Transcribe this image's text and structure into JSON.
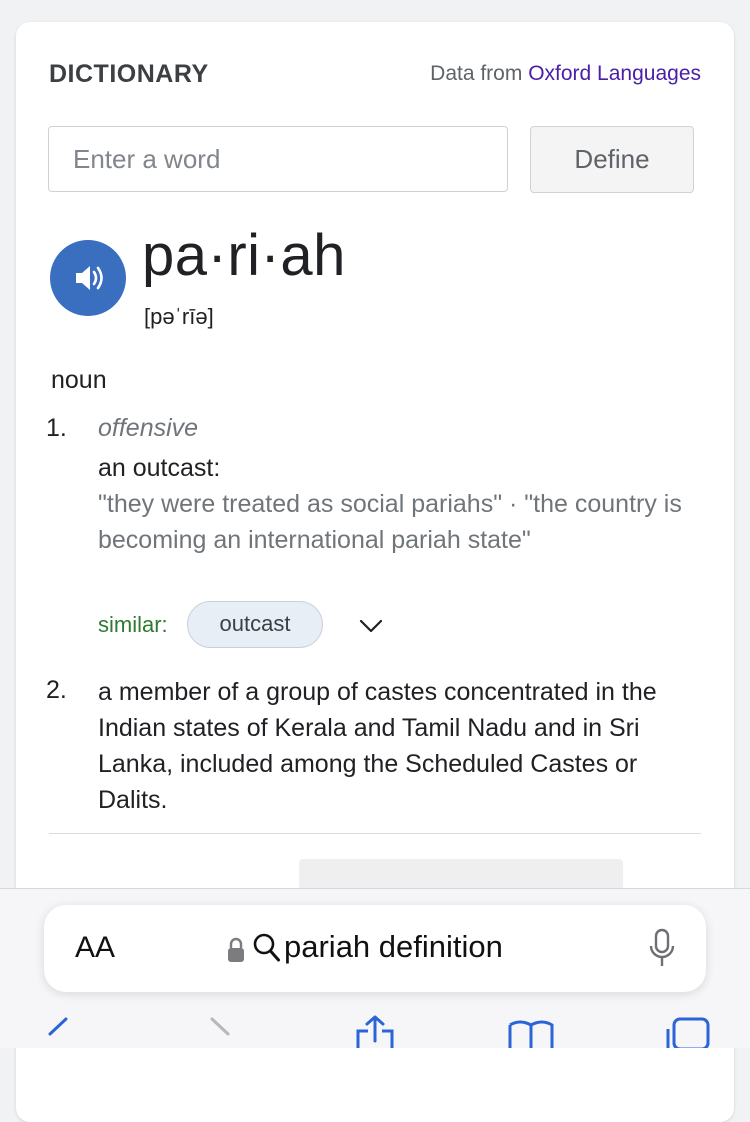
{
  "dictionary": {
    "title": "DICTIONARY",
    "source_prefix": "Data from",
    "source_link": "Oxford Languages",
    "search_placeholder": "Enter a word",
    "define_label": "Define"
  },
  "entry": {
    "headword": "pa·ri·ah",
    "phonetic": "[pəˈrīə]",
    "part_of_speech": "noun",
    "senses": [
      {
        "number": "1.",
        "label": "offensive",
        "definition": "an outcast:",
        "examples": "\"they were treated as social pariahs\"  ·  \"the country is becoming an international pariah state\"",
        "similar_label": "similar:",
        "similar": [
          "outcast"
        ]
      },
      {
        "number": "2.",
        "definition": "a member of a group of castes concentrated in the Indian states of Kerala and Tamil Nadu and in Sri Lanka, included among the Scheduled Castes or Dalits."
      }
    ]
  },
  "browser": {
    "text_size_label": "AA",
    "address_text": "pariah definition",
    "icons": [
      "lock-icon",
      "search-icon",
      "microphone-icon",
      "back-icon",
      "forward-icon",
      "share-icon",
      "bookmarks-icon",
      "tabs-icon"
    ]
  },
  "colors": {
    "link": "#4b1ea8",
    "speaker": "#3a6fbf",
    "similar": "#2e7a32",
    "muted": "#70757a"
  }
}
